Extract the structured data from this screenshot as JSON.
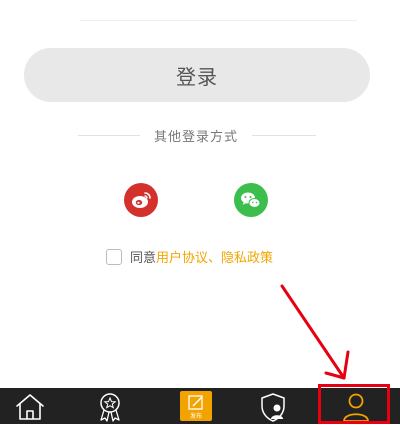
{
  "login": {
    "button_label": "登录"
  },
  "other_login": {
    "title": "其他登录方式"
  },
  "social": {
    "weibo": "weibo-icon",
    "wechat": "wechat-icon"
  },
  "agreement": {
    "prefix": "同意",
    "link": "用户协议、隐私政策"
  },
  "tabbar": {
    "publish_label": "发布"
  },
  "colors": {
    "accent": "#f2a300",
    "weibo": "#d2312c",
    "wechat": "#3bbe4b",
    "highlight": "#e60012"
  }
}
